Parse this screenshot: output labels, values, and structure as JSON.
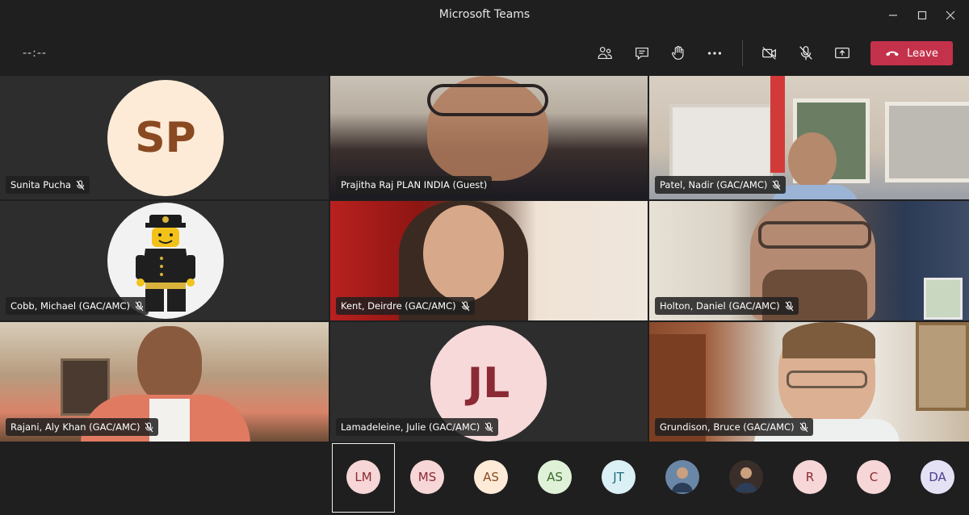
{
  "window": {
    "title": "Microsoft Teams"
  },
  "toolbar": {
    "timer": "--:--",
    "leave_label": "Leave",
    "icons": [
      "participants-icon",
      "chat-icon",
      "raise-hand-icon",
      "more-options-icon",
      "camera-off-icon",
      "mic-off-icon",
      "share-screen-icon",
      "hang-up-icon"
    ]
  },
  "tiles": [
    {
      "name": "Sunita Pucha",
      "initials": "SP",
      "avatar_bg": "#fdebd8",
      "avatar_fg": "#8a4a21"
    },
    {
      "name": "Prajitha Raj PLAN INDIA (Guest)"
    },
    {
      "name": "Patel, Nadir (GAC/AMC)"
    },
    {
      "name": "Cobb, Michael (GAC/AMC)"
    },
    {
      "name": "Kent, Deirdre (GAC/AMC)"
    },
    {
      "name": "Holton, Daniel (GAC/AMC)"
    },
    {
      "name": "Rajani, Aly Khan (GAC/AMC)"
    },
    {
      "name": "Lamadeleine, Julie (GAC/AMC)",
      "initials": "JL",
      "avatar_bg": "#f7d9d9",
      "avatar_fg": "#8b2a34"
    },
    {
      "name": "Grundison, Bruce (GAC/AMC)"
    }
  ],
  "strip": [
    {
      "initials": "LM",
      "bg": "#f6d6d6",
      "fg": "#8b2a34",
      "selected": true
    },
    {
      "initials": "MS",
      "bg": "#f6d6d6",
      "fg": "#8b2a34"
    },
    {
      "initials": "AS",
      "bg": "#fdebd8",
      "fg": "#8a4a21"
    },
    {
      "initials": "AS",
      "bg": "#dff2d8",
      "fg": "#3b6a2a"
    },
    {
      "initials": "JT",
      "bg": "#daf0f4",
      "fg": "#1f6a7a"
    },
    {
      "initials": "",
      "bg": "#6b87a8",
      "fg": "#ffffff",
      "photo": true
    },
    {
      "initials": "",
      "bg": "#3a2e2a",
      "fg": "#ffffff",
      "photo": true
    },
    {
      "initials": "R",
      "bg": "#f6d6d6",
      "fg": "#8b2a34"
    },
    {
      "initials": "C",
      "bg": "#f6d6d6",
      "fg": "#8b2a34"
    },
    {
      "initials": "DA",
      "bg": "#e5e1f5",
      "fg": "#4b3f8a"
    }
  ]
}
